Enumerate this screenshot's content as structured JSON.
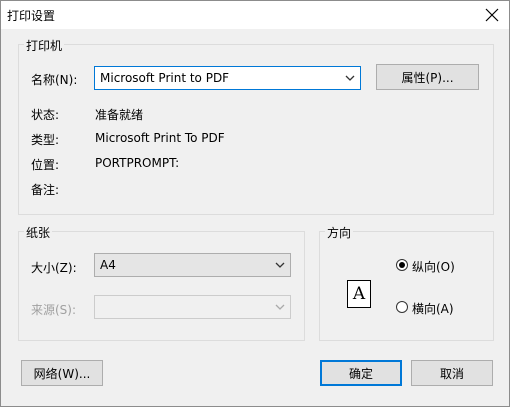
{
  "window": {
    "title": "打印设置"
  },
  "printer": {
    "group_label": "打印机",
    "name_label": "名称(N):",
    "name_value": "Microsoft Print to PDF",
    "properties_button": "属性(P)...",
    "status_label": "状态:",
    "status_value": "准备就绪",
    "type_label": "类型:",
    "type_value": "Microsoft Print To PDF",
    "location_label": "位置:",
    "location_value": "PORTPROMPT:",
    "comment_label": "备注:",
    "comment_value": ""
  },
  "paper": {
    "group_label": "纸张",
    "size_label": "大小(Z):",
    "size_value": "A4",
    "source_label": "来源(S):",
    "source_value": ""
  },
  "orientation": {
    "group_label": "方向",
    "portrait_label": "纵向(O)",
    "landscape_label": "横向(A)",
    "selected": "portrait",
    "preview_letter": "A"
  },
  "buttons": {
    "network": "网络(W)...",
    "ok": "确定",
    "cancel": "取消"
  },
  "colors": {
    "focus": "#0078d7"
  }
}
